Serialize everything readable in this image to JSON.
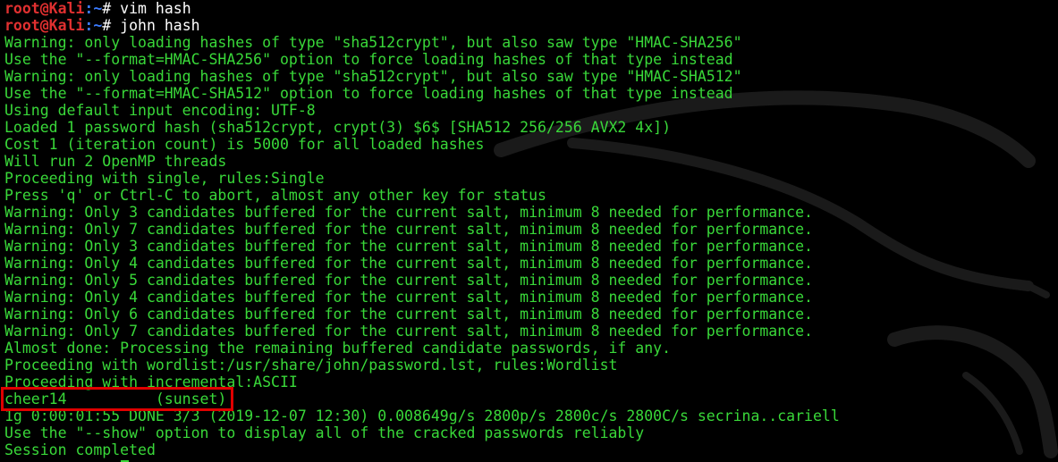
{
  "prompt": {
    "user": "root@Kali",
    "path": ":~",
    "symbol": "# "
  },
  "commands": [
    "vim hash",
    "john hash"
  ],
  "output": [
    "Warning: only loading hashes of type \"sha512crypt\", but also saw type \"HMAC-SHA256\"",
    "Use the \"--format=HMAC-SHA256\" option to force loading hashes of that type instead",
    "Warning: only loading hashes of type \"sha512crypt\", but also saw type \"HMAC-SHA512\"",
    "Use the \"--format=HMAC-SHA512\" option to force loading hashes of that type instead",
    "Using default input encoding: UTF-8",
    "Loaded 1 password hash (sha512crypt, crypt(3) $6$ [SHA512 256/256 AVX2 4x])",
    "Cost 1 (iteration count) is 5000 for all loaded hashes",
    "Will run 2 OpenMP threads",
    "Proceeding with single, rules:Single",
    "Press 'q' or Ctrl-C to abort, almost any other key for status",
    "Warning: Only 3 candidates buffered for the current salt, minimum 8 needed for performance.",
    "Warning: Only 7 candidates buffered for the current salt, minimum 8 needed for performance.",
    "Warning: Only 3 candidates buffered for the current salt, minimum 8 needed for performance.",
    "Warning: Only 4 candidates buffered for the current salt, minimum 8 needed for performance.",
    "Warning: Only 5 candidates buffered for the current salt, minimum 8 needed for performance.",
    "Warning: Only 4 candidates buffered for the current salt, minimum 8 needed for performance.",
    "Warning: Only 6 candidates buffered for the current salt, minimum 8 needed for performance.",
    "Warning: Only 7 candidates buffered for the current salt, minimum 8 needed for performance.",
    "Almost done: Processing the remaining buffered candidate passwords, if any.",
    "Proceeding with wordlist:/usr/share/john/password.lst, rules:Wordlist",
    "Proceeding with incremental:ASCII",
    "cheer14          (sunset)",
    "1g 0:00:01:55 DONE 3/3 (2019-12-07 12:30) 0.008649g/s 2800p/s 2800c/s 2800C/s secrina..cariell",
    "Use the \"--show\" option to display all of the cracked passwords reliably",
    "Session completed"
  ],
  "colors": {
    "background": "#000000",
    "output_text": "#39d839",
    "prompt_user": "#e03030",
    "prompt_path": "#3b7bff",
    "highlight_border": "#e00000"
  }
}
